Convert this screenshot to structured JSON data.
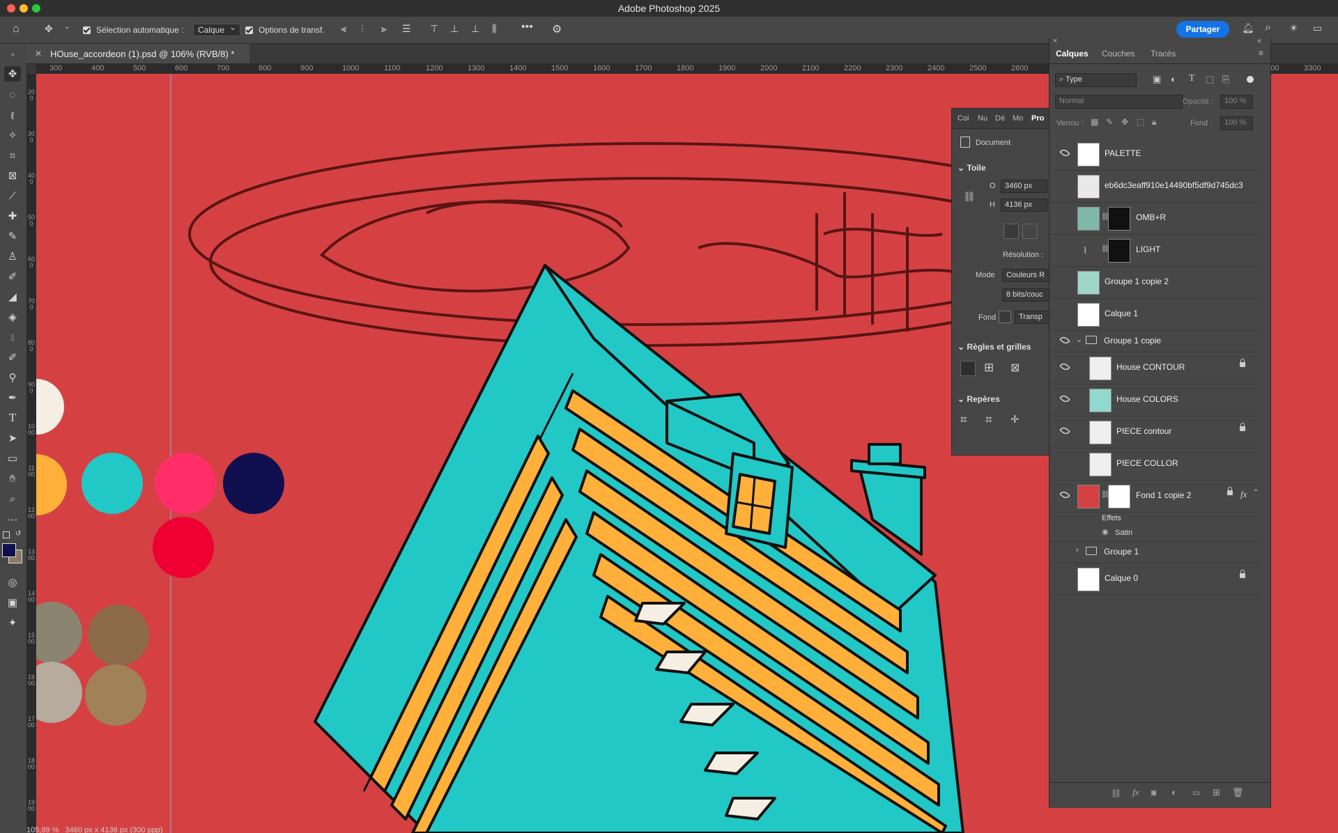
{
  "app": {
    "title": "Adobe Photoshop 2025"
  },
  "options_bar": {
    "auto_select_label": "Sélection automatique :",
    "auto_select_value": "Calque",
    "transform_options_label": "Options de transf.",
    "more_label": "•••",
    "share_label": "Partager"
  },
  "document": {
    "tab_title": "HOuse_accordeon (1).psd @ 106% (RVB/8) *",
    "close_icon": "close-icon"
  },
  "ruler": {
    "top_ticks": [
      "300",
      "400",
      "500",
      "600",
      "700",
      "800",
      "900",
      "1000",
      "1100",
      "1200",
      "1300",
      "1400",
      "1500",
      "1600",
      "1700",
      "1800",
      "1900",
      "2000",
      "2100",
      "2200",
      "2300",
      "2400",
      "2500",
      "2600",
      "2700",
      "2800",
      "2900",
      "3000",
      "3100",
      "3200",
      "3300"
    ],
    "left_ticks": [
      "200",
      "300",
      "400",
      "500",
      "600",
      "700",
      "800",
      "900",
      "1000",
      "1100",
      "1200",
      "1300",
      "1400",
      "1500",
      "1600",
      "1700",
      "1800",
      "1900"
    ]
  },
  "properties_panel": {
    "tabs": [
      "Coi",
      "Nu",
      "Dé",
      "Mo",
      "Pro"
    ],
    "document_label": "Document",
    "canvas_section": "Toile",
    "width_label": "O",
    "width_value": "3460 px",
    "height_label": "H",
    "height_value": "4136 px",
    "resolution_label": "Résolution :",
    "mode_label": "Mode",
    "mode_value": "Couleurs R",
    "bits_value": "8 bits/couc",
    "background_label": "Fond",
    "background_value": "Transp",
    "rulers_section": "Règles et grilles",
    "guides_section": "Repères"
  },
  "layers_panel": {
    "tabs": [
      "Calques",
      "Couches",
      "Tracés"
    ],
    "filter_value": "Type",
    "blend_mode": "Normal",
    "opacity_label": "Opacité :",
    "opacity_value": "100 %",
    "lock_label": "Verrou :",
    "fill_label": "Fond :",
    "fill_value": "100 %",
    "layers": [
      {
        "name": "PALETTE"
      },
      {
        "name": "eb6dc3eaff910e14490bf5df9d745dc3"
      },
      {
        "name": "OMB+R"
      },
      {
        "name": "LIGHT"
      },
      {
        "name": "Groupe 1 copie 2"
      },
      {
        "name": "Calque 1"
      },
      {
        "name": "Groupe 1 copie"
      },
      {
        "name": "House CONTOUR"
      },
      {
        "name": "House COLORS"
      },
      {
        "name": "PIECE contour"
      },
      {
        "name": "PIECE COLLOR"
      },
      {
        "name": "Fond 1 copie 2"
      },
      {
        "name": "Groupe 1"
      },
      {
        "name": "Calque 0"
      }
    ],
    "effects_label": "Effets",
    "satin_label": "Satin",
    "fx_label": "fx"
  },
  "status_bar": {
    "zoom": "105,99 %",
    "dimensions": "3460 px x 4136 px (300 ppp)"
  },
  "colors": {
    "canvas_red": "#d54143",
    "house_teal": "#22c8c6",
    "house_yellow": "#ffb03a",
    "accent_blue": "#1473e6"
  }
}
